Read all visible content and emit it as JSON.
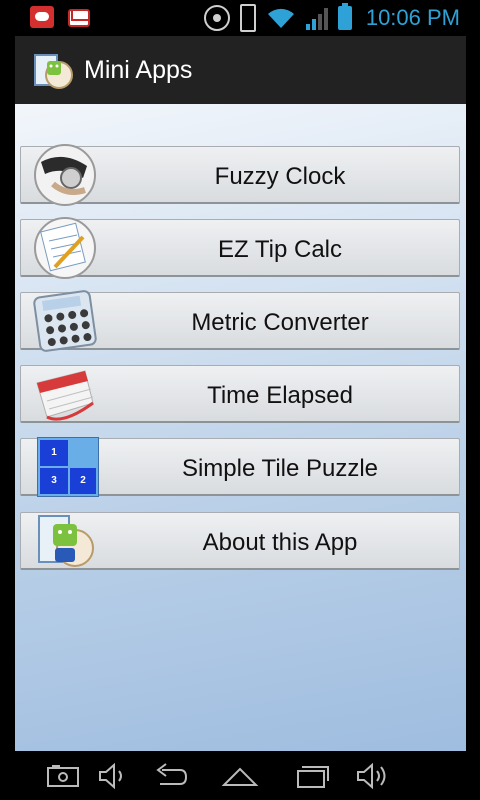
{
  "status_bar": {
    "time": "10:06 PM"
  },
  "action_bar": {
    "title": "Mini Apps"
  },
  "menu": [
    {
      "label": "Fuzzy Clock",
      "icon": "watch-icon"
    },
    {
      "label": "EZ Tip Calc",
      "icon": "guest-check-icon"
    },
    {
      "label": "Metric Converter",
      "icon": "calculator-icon"
    },
    {
      "label": "Time Elapsed",
      "icon": "calendar-icon"
    },
    {
      "label": "Simple Tile Puzzle",
      "icon": "tile-puzzle-icon",
      "tiles": [
        "1",
        "3",
        "2"
      ]
    },
    {
      "label": "About this App",
      "icon": "android-app-icon"
    }
  ],
  "colors": {
    "accent": "#2ea2d6",
    "tile_blue": "#1a3fd6"
  }
}
